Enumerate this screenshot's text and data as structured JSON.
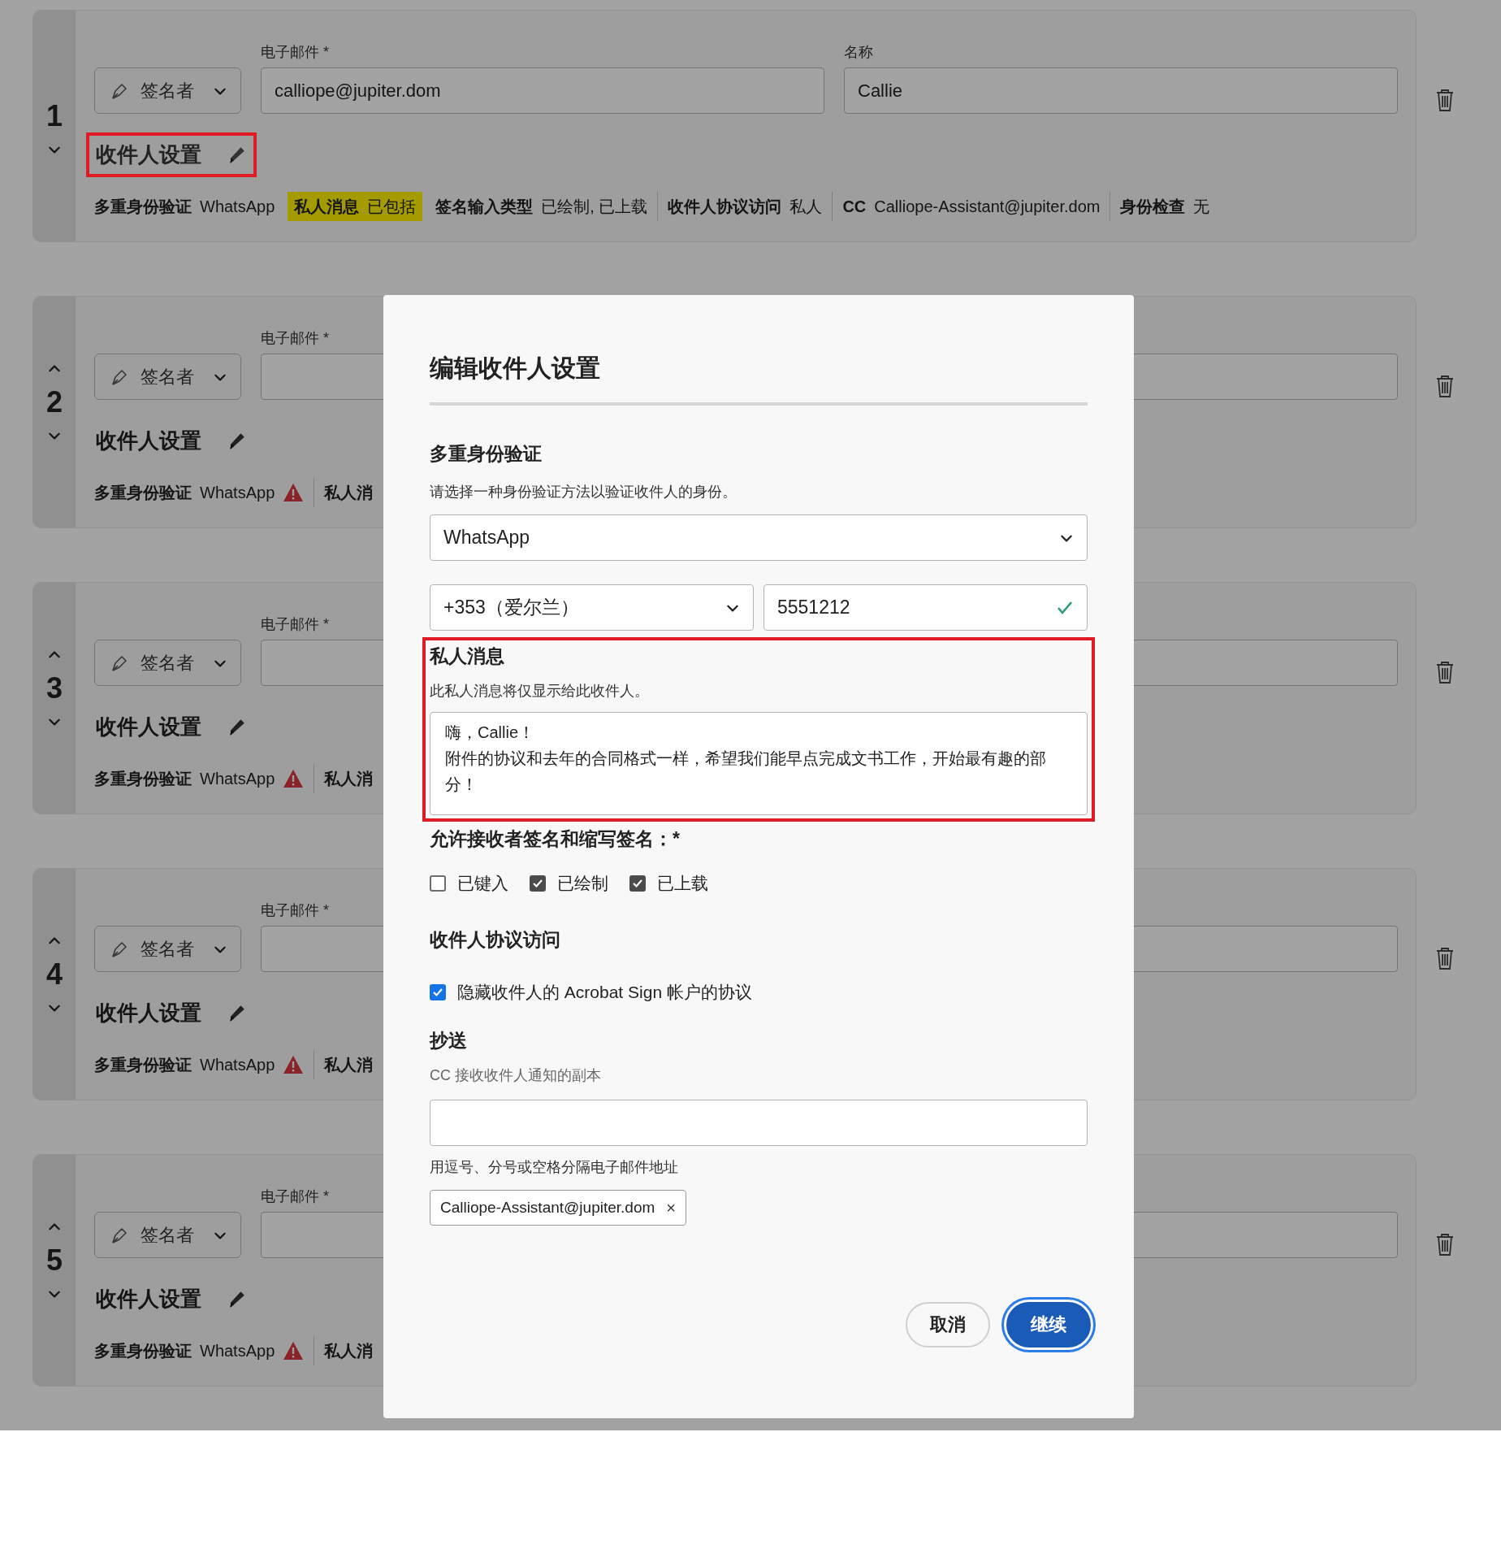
{
  "recipients": [
    {
      "number": "1",
      "move_up": false,
      "move_down": true,
      "role": "签名者",
      "email_label": "电子邮件 *",
      "email": "calliope@jupiter.dom",
      "name_label": "名称",
      "name": "Callie",
      "settings_label": "收件人设置",
      "settings_highlighted": true,
      "summary": [
        {
          "label": "多重身份验证",
          "value": "WhatsApp",
          "warning": false,
          "highlighted": false
        },
        {
          "label": "私人消息",
          "value": "已包括",
          "warning": false,
          "highlighted": true
        },
        {
          "label": "签名输入类型",
          "value": "已绘制, 已上载",
          "warning": false,
          "highlighted": false
        },
        {
          "label": "收件人协议访问",
          "value": "私人",
          "warning": false,
          "highlighted": false
        },
        {
          "label": "CC",
          "value": "Calliope-Assistant@jupiter.dom",
          "warning": false,
          "highlighted": false
        },
        {
          "label": "身份检查",
          "value": "无",
          "warning": false,
          "highlighted": false
        }
      ]
    },
    {
      "number": "2",
      "move_up": true,
      "move_down": true,
      "role": "签名者",
      "email_label": "电子邮件 *",
      "settings_label": "收件人设置",
      "settings_highlighted": false,
      "summary": [
        {
          "label": "多重身份验证",
          "value": "WhatsApp",
          "warning": true,
          "highlighted": false
        },
        {
          "label": "私人消",
          "warning": false,
          "highlighted": false
        }
      ]
    },
    {
      "number": "3",
      "move_up": true,
      "move_down": true,
      "role": "签名者",
      "email_label": "电子邮件 *",
      "settings_label": "收件人设置",
      "settings_highlighted": false,
      "summary": [
        {
          "label": "多重身份验证",
          "value": "WhatsApp",
          "warning": true,
          "highlighted": false
        },
        {
          "label": "私人消",
          "warning": false,
          "highlighted": false
        }
      ]
    },
    {
      "number": "4",
      "move_up": true,
      "move_down": true,
      "role": "签名者",
      "email_label": "电子邮件 *",
      "settings_label": "收件人设置",
      "settings_highlighted": false,
      "summary": [
        {
          "label": "多重身份验证",
          "value": "WhatsApp",
          "warning": true,
          "highlighted": false
        },
        {
          "label": "私人消",
          "warning": false,
          "highlighted": false
        }
      ]
    },
    {
      "number": "5",
      "move_up": true,
      "move_down": true,
      "role": "签名者",
      "email_label": "电子邮件 *",
      "settings_label": "收件人设置",
      "settings_highlighted": false,
      "summary": [
        {
          "label": "多重身份验证",
          "value": "WhatsApp",
          "warning": true,
          "highlighted": false
        },
        {
          "label": "私人消",
          "warning": false,
          "highlighted": false
        }
      ]
    }
  ],
  "dialog": {
    "title": "编辑收件人设置",
    "auth": {
      "heading": "多重身份验证",
      "description": "请选择一种身份验证方法以验证收件人的身份。",
      "method": "WhatsApp",
      "country": "+353（爱尔兰）",
      "phone": "5551212",
      "phone_valid": true
    },
    "message": {
      "heading": "私人消息",
      "description": "此私人消息将仅显示给此收件人。",
      "lines": [
        "嗨，Callie！",
        "附件的协议和去年的合同格式一样，希望我们能早点完成文书工作，开始最有趣的部分！"
      ],
      "highlighted": true
    },
    "signature_types": {
      "heading": "允许接收者签名和缩写签名：*",
      "options": [
        {
          "label": "已键入",
          "checked": false
        },
        {
          "label": "已绘制",
          "checked": true
        },
        {
          "label": "已上载",
          "checked": true
        }
      ]
    },
    "access": {
      "heading": "收件人协议访问",
      "options": [
        {
          "label": "隐藏收件人的 Acrobat Sign 帐户的协议",
          "checked": true
        }
      ]
    },
    "cc": {
      "heading": "抄送",
      "description": "CC 接收收件人通知的副本",
      "help": "用逗号、分号或空格分隔电子邮件地址",
      "chips": [
        {
          "label": "Calliope-Assistant@jupiter.dom",
          "remove": "×"
        }
      ]
    },
    "buttons": [
      {
        "label": "取消",
        "kind": "secondary",
        "focused": false
      },
      {
        "label": "继续",
        "kind": "primary",
        "focused": true
      }
    ]
  }
}
